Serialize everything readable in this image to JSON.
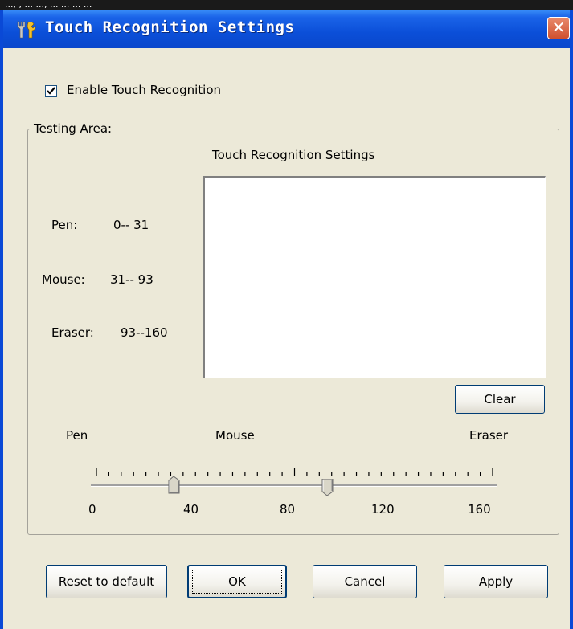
{
  "top_strip": {
    "text": "..., , ... ..., ... ... ... ..."
  },
  "window": {
    "title": "Touch Recognition Settings",
    "close_label": "✕"
  },
  "enable": {
    "label": "Enable Touch Recognition",
    "checked": true
  },
  "testing_area": {
    "group_title": "Testing Area:",
    "title": "Touch Recognition Settings",
    "ranges": [
      {
        "label": "Pen:",
        "value": "0-- 31"
      },
      {
        "label": "Mouse:",
        "value": "31-- 93"
      },
      {
        "label": "Eraser:",
        "value": "93--160"
      }
    ],
    "clear_label": "Clear"
  },
  "slider": {
    "labels": {
      "pen": "Pen",
      "mouse": "Mouse",
      "eraser": "Eraser"
    },
    "ticks": [
      "0",
      "40",
      "80",
      "120",
      "160"
    ],
    "min": 0,
    "max": 160,
    "thumb_values": [
      31,
      93
    ]
  },
  "buttons": {
    "reset": "Reset to default",
    "ok": "OK",
    "cancel": "Cancel",
    "apply": "Apply"
  },
  "colors": {
    "title_bar": "#0b4fd8",
    "dialog_bg": "#ece9d8",
    "close_button": "#d0502e"
  }
}
